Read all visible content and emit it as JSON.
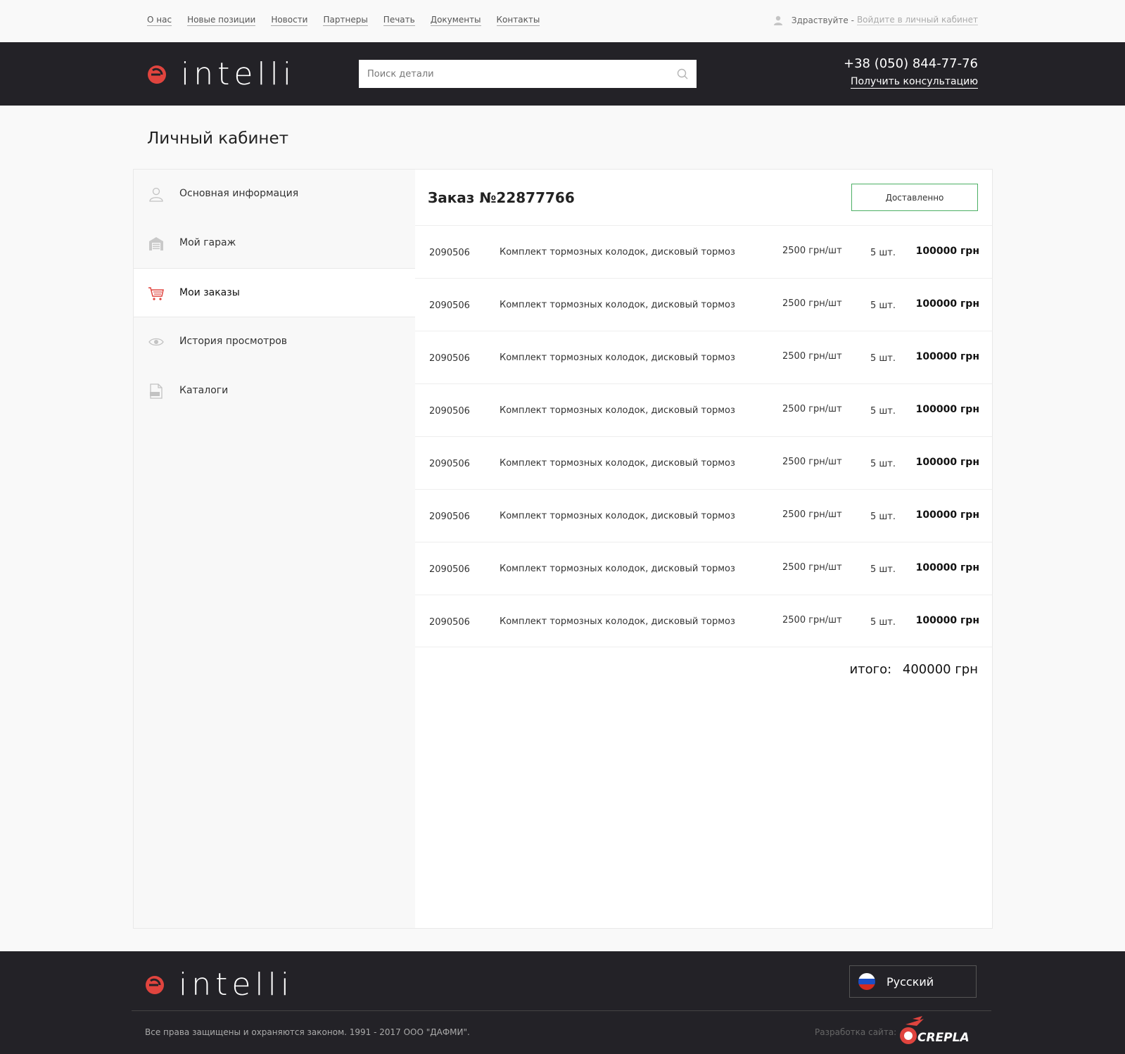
{
  "topnav": {
    "links": [
      "О нас",
      "Новые позиции",
      "Новости",
      "Партнеры",
      "Печать",
      "Документы",
      "Контакты"
    ],
    "greeting": "Здраствуйте -",
    "login_link": "Войдите в личный кабинет",
    "user_icon": "user-icon"
  },
  "header": {
    "logo_text": "intelli",
    "search_placeholder": "Поиск детали",
    "search_icon": "search-icon",
    "phone": "+38 (050) 844-77-76",
    "consult": "Получить консультацию"
  },
  "page": {
    "title": "Личный кабинет"
  },
  "sidebar": {
    "items": [
      {
        "label": "Основная информация",
        "icon": "user-icon",
        "active": false
      },
      {
        "label": "Мой гараж",
        "icon": "garage-icon",
        "active": false
      },
      {
        "label": "Мои заказы",
        "icon": "cart-icon",
        "active": true
      },
      {
        "label": "История просмотров",
        "icon": "eye-icon",
        "active": false
      },
      {
        "label": "Каталоги",
        "icon": "pdf-file-icon",
        "active": false
      }
    ]
  },
  "order": {
    "title": "Заказ №22877766",
    "status": "Доставленно",
    "rows": [
      {
        "code": "2090506",
        "name": "Комплект тормозных колодок, дисковый тормоз",
        "price": "2500 грн/шт",
        "qty": "5 шт.",
        "total": "100000 грн"
      },
      {
        "code": "2090506",
        "name": "Комплект тормозных колодок, дисковый тормоз",
        "price": "2500 грн/шт",
        "qty": "5 шт.",
        "total": "100000 грн"
      },
      {
        "code": "2090506",
        "name": "Комплект тормозных колодок, дисковый тормоз",
        "price": "2500 грн/шт",
        "qty": "5 шт.",
        "total": "100000 грн"
      },
      {
        "code": "2090506",
        "name": "Комплект тормозных колодок, дисковый тормоз",
        "price": "2500 грн/шт",
        "qty": "5 шт.",
        "total": "100000 грн"
      },
      {
        "code": "2090506",
        "name": "Комплект тормозных колодок, дисковый тормоз",
        "price": "2500 грн/шт",
        "qty": "5 шт.",
        "total": "100000 грн"
      },
      {
        "code": "2090506",
        "name": "Комплект тормозных колодок, дисковый тормоз",
        "price": "2500 грн/шт",
        "qty": "5 шт.",
        "total": "100000 грн"
      },
      {
        "code": "2090506",
        "name": "Комплект тормозных колодок, дисковый тормоз",
        "price": "2500 грн/шт",
        "qty": "5 шт.",
        "total": "100000 грн"
      },
      {
        "code": "2090506",
        "name": "Комплект тормозных колодок, дисковый тормоз",
        "price": "2500 грн/шт",
        "qty": "5 шт.",
        "total": "100000 грн"
      }
    ],
    "grand_label": "итого:",
    "grand_total": "400000 грн"
  },
  "footer": {
    "logo_text": "intelli",
    "language": "Русский",
    "flag_icon": "russia-flag-icon",
    "copyright": "Все права защищены и охраняются законом. 1991 - 2017 ООО \"ДАФМИ\".",
    "dev_label": "Разработка сайта:",
    "dev_logo_text": "CREPLA"
  },
  "colors": {
    "accent": "#e0443e",
    "header_bg": "#232227",
    "status_border": "#4caf64"
  }
}
